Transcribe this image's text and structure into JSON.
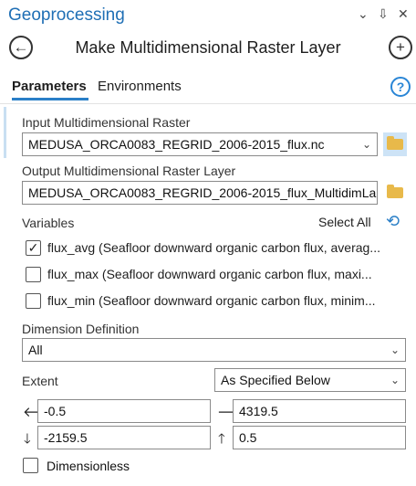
{
  "pane": {
    "title": "Geoprocessing",
    "controls": [
      "⌄",
      "⇩",
      "✕"
    ]
  },
  "tool": {
    "title": "Make Multidimensional Raster Layer",
    "back_icon": "back-arrow-icon",
    "add_icon": "plus-icon"
  },
  "tabs": [
    {
      "label": "Parameters",
      "active": true
    },
    {
      "label": "Environments",
      "active": false
    }
  ],
  "help_label": "?",
  "input_raster": {
    "label": "Input Multidimensional Raster",
    "value": "MEDUSA_ORCA0083_REGRID_2006-2015_flux.nc"
  },
  "output_layer": {
    "label": "Output Multidimensional Raster Layer",
    "value": "MEDUSA_ORCA0083_REGRID_2006-2015_flux_MultidimLa"
  },
  "variables": {
    "label": "Variables",
    "select_all": "Select All",
    "items": [
      {
        "text": "flux_avg (Seafloor downward organic carbon flux, averag...",
        "checked": true
      },
      {
        "text": "flux_max (Seafloor downward organic carbon flux, maxi...",
        "checked": false
      },
      {
        "text": "flux_min (Seafloor downward organic carbon flux, minim...",
        "checked": false
      }
    ]
  },
  "dimension_definition": {
    "label": "Dimension Definition",
    "value": "All"
  },
  "extent": {
    "label": "Extent",
    "mode": "As Specified Below",
    "left": "-0.5",
    "right": "4319.5",
    "bottom": "-2159.5",
    "top": "0.5"
  },
  "dimensionless": {
    "label": "Dimensionless",
    "checked": false
  },
  "colors": {
    "accent": "#1f6fb5",
    "folder": "#e8b94a"
  }
}
